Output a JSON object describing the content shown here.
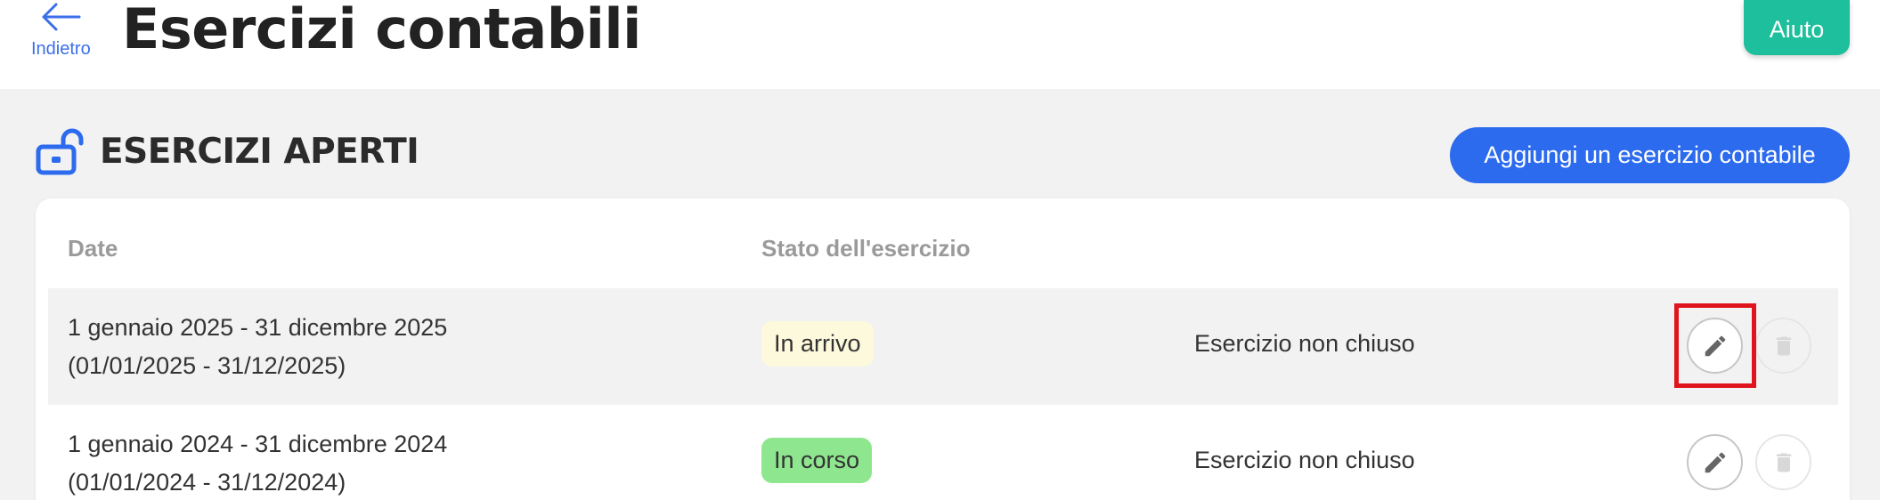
{
  "header": {
    "back_label": "Indietro",
    "title": "Esercizi contabili",
    "help_label": "Aiuto"
  },
  "section": {
    "icon": "unlocked-padlock-icon",
    "title": "ESERCIZI APERTI",
    "add_button_label": "Aggiungi un esercizio contabile"
  },
  "table": {
    "columns": [
      "Date",
      "Stato dell'esercizio"
    ],
    "rows": [
      {
        "date_range": "1 gennaio 2025 - 31 dicembre 2025",
        "date_numeric": "(01/01/2025 - 31/12/2025)",
        "state": "In arrivo",
        "state_color": "#fdf9dc",
        "closure": "Esercizio non chiuso"
      },
      {
        "date_range": "1 gennaio 2024 - 31 dicembre 2024",
        "date_numeric": "(01/01/2024 - 31/12/2024)",
        "state": "In corso",
        "state_color": "#8ee68e",
        "closure": "Esercizio non chiuso"
      }
    ]
  },
  "colors": {
    "accent_blue": "#2c6bed",
    "help_green": "#1dbf9c",
    "highlight_red": "#e0141c"
  },
  "icons": {
    "back": "arrow-left-icon",
    "edit": "pencil-icon",
    "delete": "trash-icon"
  }
}
